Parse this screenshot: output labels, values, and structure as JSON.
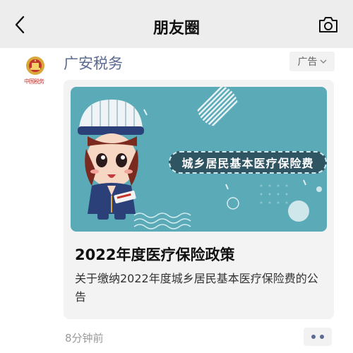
{
  "header": {
    "title": "朋友圈",
    "back_icon": "chevron-left-icon",
    "camera_icon": "camera-icon"
  },
  "post": {
    "account_name": "广安税务",
    "logo_text": "中国税务",
    "ad_label": "广告",
    "banner_text": "城乡居民基本医疗保险费",
    "card_title": "2022年度医疗保险政策",
    "card_desc": "关于缴纳2022年度城乡居民基本医疗保险费的公告",
    "time": "8分钟前"
  },
  "colors": {
    "header_bg": "#ededed",
    "account_name": "#5b6b92",
    "banner_bg": "#5aaab8",
    "banner_label_bg": "#2f5563"
  }
}
